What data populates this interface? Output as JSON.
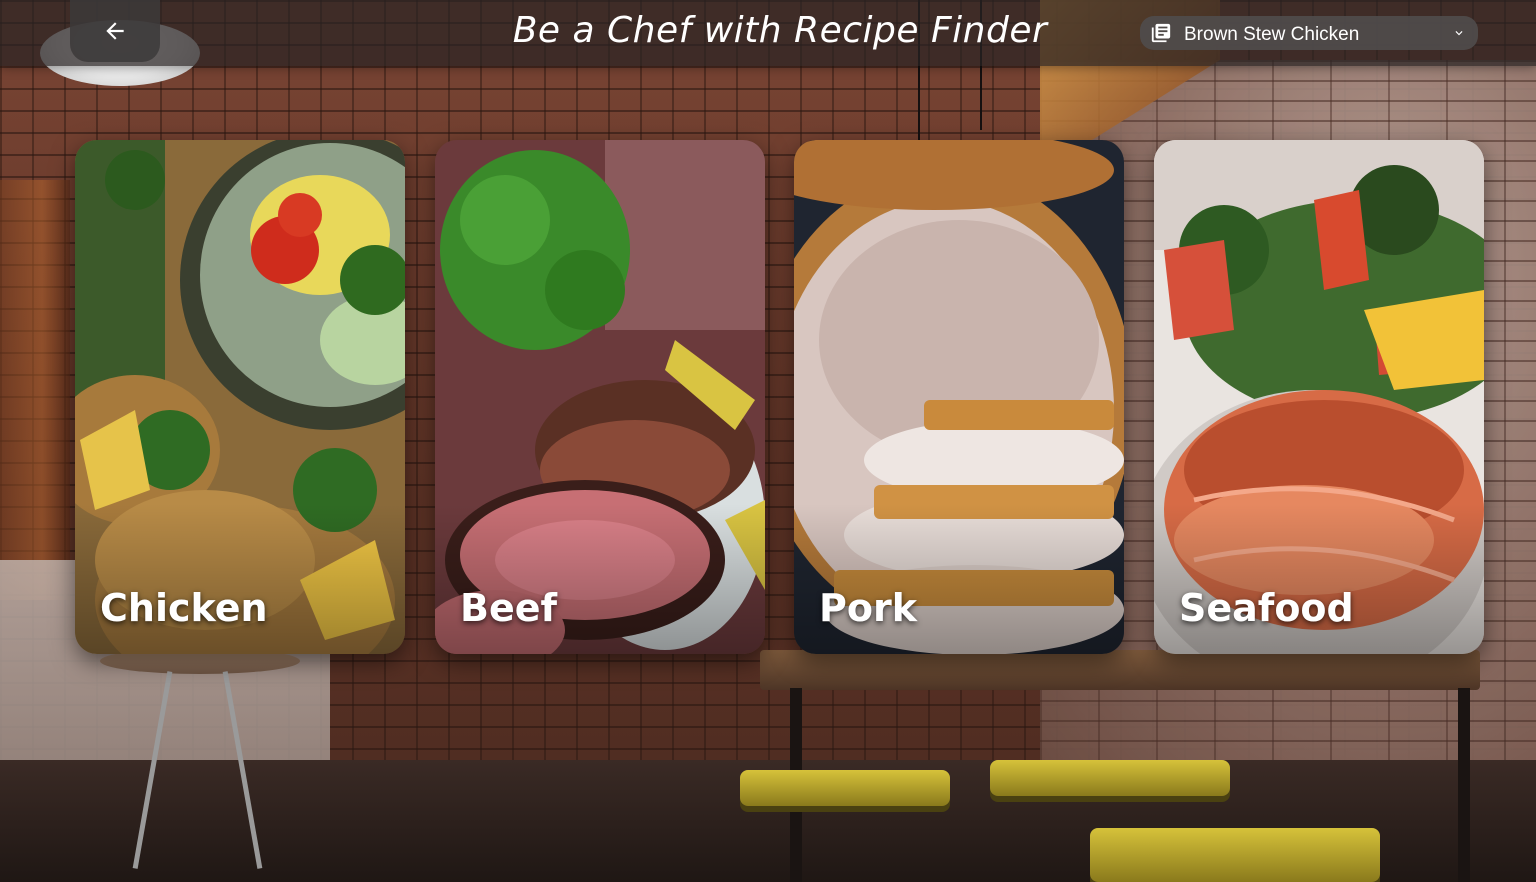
{
  "header": {
    "title": "Be a Chef with Recipe Finder",
    "back_icon": "arrow-left-icon",
    "recipe_select": {
      "selected": "Brown Stew Chicken",
      "icon": "recipe-list-icon"
    }
  },
  "categories": [
    {
      "label": "Chicken"
    },
    {
      "label": "Beef"
    },
    {
      "label": "Pork"
    },
    {
      "label": "Seafood"
    }
  ],
  "colors": {
    "header_bg": "#282222",
    "text": "#ffffff",
    "select_bg": "#504c4c"
  }
}
